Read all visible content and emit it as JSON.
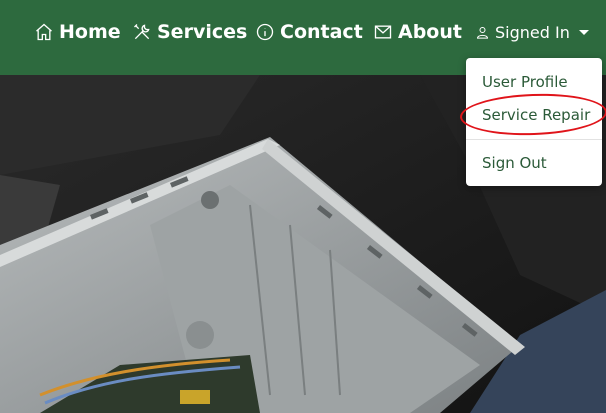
{
  "nav": {
    "home": "Home",
    "services": "Services",
    "contact": "Contact",
    "about": "About",
    "user": "Signed In"
  },
  "dropdown": {
    "items": [
      "User Profile",
      "Service Repair",
      "Sign Out"
    ]
  },
  "colors": {
    "navbar": "#2d6a3e",
    "dropdown_text": "#2b5a38",
    "annotation": "#e0141a"
  },
  "icons": {
    "home": "home-icon",
    "services": "tools-icon",
    "contact": "info-icon",
    "about": "envelope-icon",
    "user": "user-icon"
  }
}
